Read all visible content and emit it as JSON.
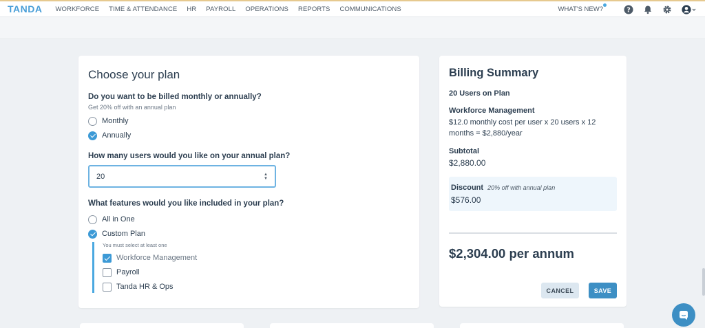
{
  "brand": {
    "logo": "TANDA",
    "accent": "#4aa8e0"
  },
  "nav": {
    "items": [
      "WORKFORCE",
      "TIME & ATTENDANCE",
      "HR",
      "PAYROLL",
      "OPERATIONS",
      "REPORTS",
      "COMMUNICATIONS"
    ],
    "whats_new": "WHAT'S NEW?",
    "icons": [
      "help-icon",
      "bell-icon",
      "gear-icon",
      "account-icon"
    ]
  },
  "plan": {
    "title": "Choose your plan",
    "billing_question": "Do you want to be billed monthly or annually?",
    "billing_hint": "Get 20% off with an annual plan",
    "billing_options": [
      {
        "label": "Monthly",
        "checked": false
      },
      {
        "label": "Annually",
        "checked": true
      }
    ],
    "users_question": "How many users would you like on your annual plan?",
    "users_value": "20",
    "features_question": "What features would you like included in your plan?",
    "feature_options": [
      {
        "label": "All in One",
        "checked": false
      },
      {
        "label": "Custom Plan",
        "checked": true
      }
    ],
    "custom_hint": "You must select at least one",
    "custom_items": [
      {
        "label": "Workforce Management",
        "checked": true
      },
      {
        "label": "Payroll",
        "checked": false
      },
      {
        "label": "Tanda HR & Ops",
        "checked": false
      }
    ]
  },
  "billing": {
    "title": "Billing Summary",
    "users_on_plan": "20 Users on Plan",
    "product_heading": "Workforce Management",
    "product_detail": "$12.0 monthly cost per user x 20 users x 12 months = $2,880/year",
    "subtotal_label": "Subtotal",
    "subtotal_value": "$2,880.00",
    "discount_label": "Discount",
    "discount_note": "20% off with annual plan",
    "discount_value": "$576.00",
    "total": "$2,304.00 per annum",
    "cancel_label": "CANCEL",
    "save_label": "SAVE"
  }
}
